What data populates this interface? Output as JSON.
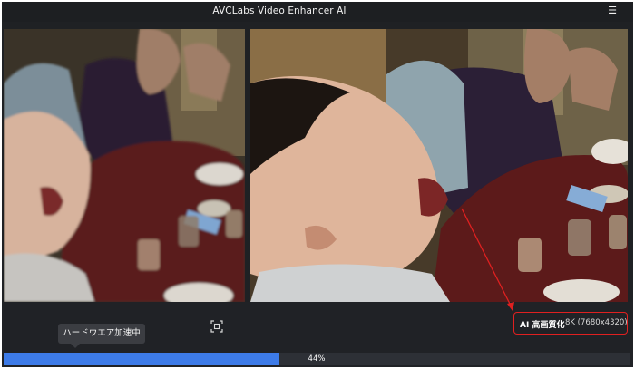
{
  "app": {
    "title": "AVCLabs Video Enhancer AI",
    "menu_icon": "hamburger-menu-icon"
  },
  "preview": {
    "left_label": "original-preview",
    "right_label": "enhanced-preview",
    "compare_icon": "compare-frame-icon"
  },
  "status": {
    "tooltip": "ハードウエア加速中",
    "ai_label": "AI 高画質化",
    "ai_value": "8K (7680x4320)",
    "accent_color": "#e02020"
  },
  "progress": {
    "percent": 44,
    "text": "44%",
    "fill_color": "#3d7be8"
  }
}
